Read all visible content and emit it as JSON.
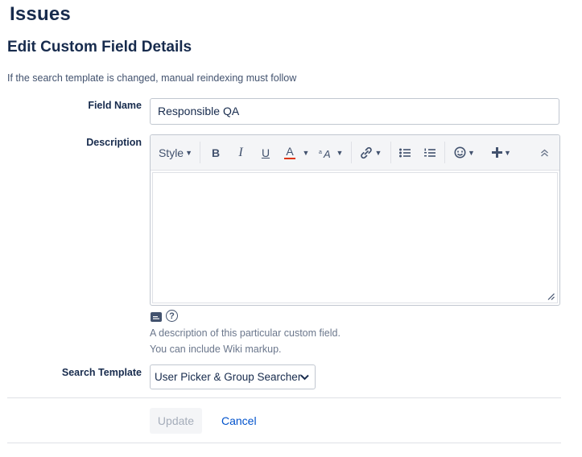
{
  "page": {
    "title": "Issues"
  },
  "form": {
    "title": "Edit Custom Field Details",
    "notice": "If the search template is changed, manual reindexing must follow"
  },
  "field_name": {
    "label": "Field Name",
    "value": "Responsible QA"
  },
  "description": {
    "label": "Description",
    "toolbar": {
      "style_label": "Style",
      "bold": "B",
      "italic": "I",
      "underline": "U",
      "text_color": "A"
    },
    "help_line1": "A description of this particular custom field.",
    "help_line2": "You can include Wiki markup."
  },
  "search_template": {
    "label": "Search Template",
    "selected": "User Picker & Group Searcher"
  },
  "actions": {
    "update_label": "Update",
    "cancel_label": "Cancel"
  },
  "colors": {
    "accent": "#0052cc",
    "text_color_underline": "#de350b",
    "heading": "#172b4d"
  }
}
